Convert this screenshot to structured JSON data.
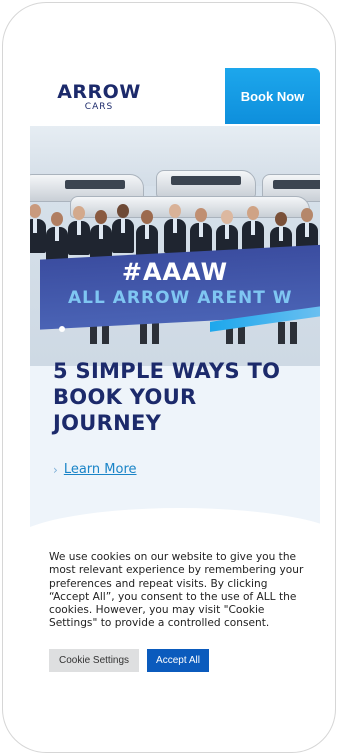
{
  "header": {
    "logo_main": "ARROW",
    "logo_sub": "CARS",
    "book_now": "Book Now"
  },
  "hero": {
    "banner_title": "#AAAW",
    "banner_sub": "ALL ARROW ARENT W",
    "title": "5 SIMPLE WAYS TO BOOK YOUR JOURNEY",
    "learn_more": "Learn More",
    "chevron_icon": "chevron-right-icon"
  },
  "cookie": {
    "text": "We use cookies on our website to give you the most relevant experience by remembering your preferences and repeat visits. By clicking “Accept All”, you consent to the use of ALL the cookies. However, you may visit \"Cookie Settings\" to provide a controlled consent.",
    "settings_label": "Cookie Settings",
    "accept_label": "Accept All"
  },
  "colors": {
    "brand_navy": "#1c2a6b",
    "accent_blue": "#1da7ec",
    "accept_blue": "#0b5bbd"
  }
}
